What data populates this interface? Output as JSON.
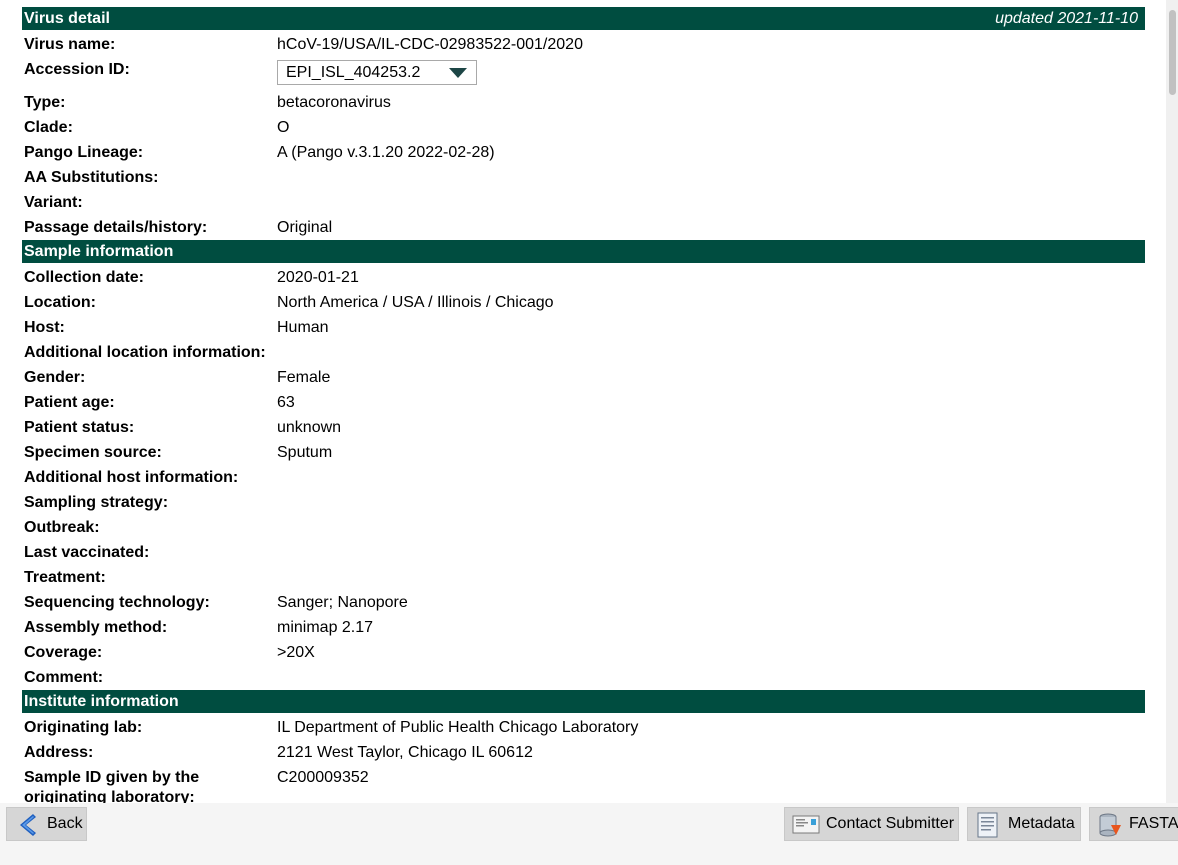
{
  "virus_detail": {
    "title": "Virus detail",
    "updated": "updated 2021-11-10",
    "virus_name_label": "Virus name:",
    "virus_name": "hCoV-19/USA/IL-CDC-02983522-001/2020",
    "accession_label": "Accession ID:",
    "accession": "EPI_ISL_404253.2",
    "type_label": "Type:",
    "type": "betacoronavirus",
    "clade_label": "Clade:",
    "clade": "O",
    "pango_label": "Pango Lineage:",
    "pango": "A (Pango v.3.1.20 2022-02-28)",
    "aa_label": "AA Substitutions:",
    "aa": "",
    "variant_label": "Variant:",
    "variant": "",
    "passage_label": "Passage details/history:",
    "passage": "Original"
  },
  "sample_info": {
    "title": "Sample information",
    "collection_date_label": "Collection date:",
    "collection_date": "2020-01-21",
    "location_label": "Location:",
    "location": "North America / USA / Illinois / Chicago",
    "host_label": "Host:",
    "host": "Human",
    "add_location_label": "Additional location information:",
    "add_location": "",
    "gender_label": "Gender:",
    "gender": "Female",
    "age_label": "Patient age:",
    "age": "63",
    "status_label": "Patient status:",
    "status": "unknown",
    "specimen_label": "Specimen source:",
    "specimen": "Sputum",
    "add_host_label": "Additional host information:",
    "add_host": "",
    "sampling_label": "Sampling strategy:",
    "sampling": "",
    "outbreak_label": "Outbreak:",
    "outbreak": "",
    "vaccinated_label": "Last vaccinated:",
    "vaccinated": "",
    "treatment_label": "Treatment:",
    "treatment": "",
    "seqtech_label": "Sequencing technology:",
    "seqtech": "Sanger; Nanopore",
    "assembly_label": "Assembly method:",
    "assembly": "minimap 2.17",
    "coverage_label": "Coverage:",
    "coverage": ">20X",
    "comment_label": "Comment:",
    "comment": ""
  },
  "institute_info": {
    "title": "Institute information",
    "lab_label": "Originating lab:",
    "lab": "IL Department of Public Health Chicago Laboratory",
    "address_label": "Address:",
    "address": "2121 West Taylor, Chicago IL 60612",
    "sample_id_label": "Sample ID given by the originating laboratory:",
    "sample_id": "C200009352"
  },
  "buttons": {
    "back": "Back",
    "contact": "Contact Submitter",
    "metadata": "Metadata",
    "fasta": "FASTA"
  },
  "colors": {
    "header_bg": "#004d40",
    "button_bg": "#d6d6d6"
  }
}
